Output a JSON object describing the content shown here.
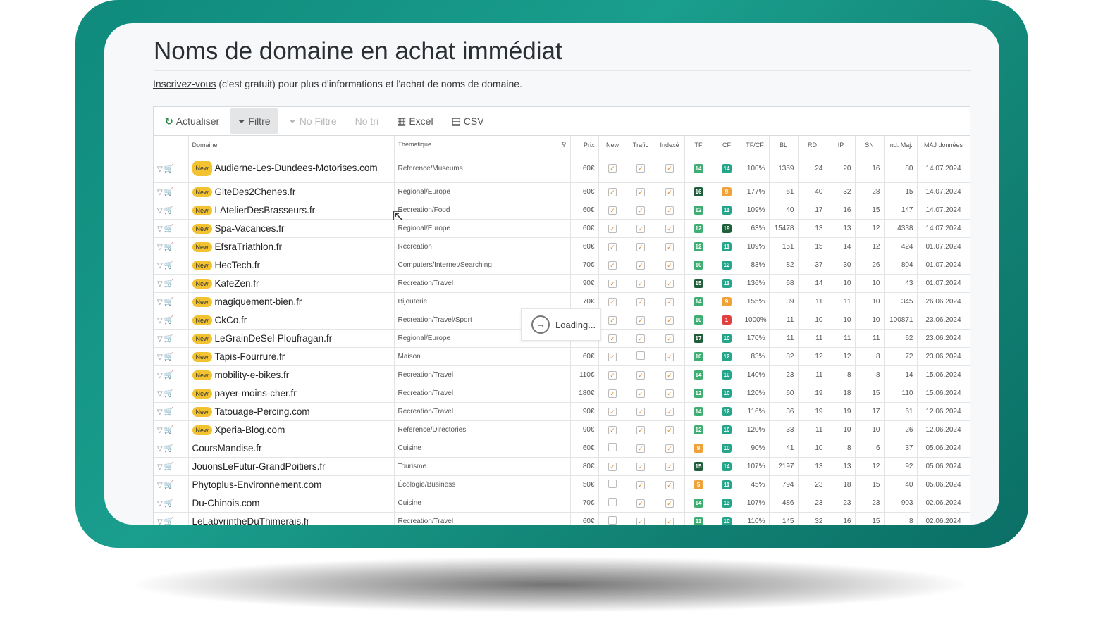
{
  "page": {
    "title": "Noms de domaine en achat immédiat",
    "intro_link": "Inscrivez-vous",
    "intro_text": " (c'est gratuit) pour plus d'informations et l'achat de noms de domaine."
  },
  "toolbar": {
    "refresh": "Actualiser",
    "filter": "Filtre",
    "no_filter": "No Filtre",
    "no_sort": "No tri",
    "excel": "Excel",
    "csv": "CSV"
  },
  "columns": {
    "domain": "Domaine",
    "theme": "Thématique",
    "price": "Prix",
    "new": "New",
    "traffic": "Trafic",
    "indexed": "Indexé",
    "tf": "TF",
    "cf": "CF",
    "tfcf": "TF/CF",
    "bl": "BL",
    "rd": "RD",
    "ip": "IP",
    "sn": "SN",
    "ind": "Ind. Maj.",
    "maj": "MAJ données"
  },
  "badge_new": "New",
  "loading": "Loading...",
  "colors": {
    "tf_green": "#3fae73",
    "tf_dark": "#1f5e3b",
    "cf_orange": "#f0a23a",
    "cf_red": "#e04040",
    "cf_teal": "#27a58a"
  },
  "rows": [
    {
      "domain": "Audierne-Les-Dundees-Motorises.com",
      "new": true,
      "theme": "Reference/Museums",
      "price": "60€",
      "n": true,
      "t": true,
      "i": true,
      "tf": "14",
      "tfc": "tf_green",
      "cf": "14",
      "cfc": "cf_teal",
      "tfcf": "100%",
      "bl": "1359",
      "rd": "24",
      "ip": "20",
      "sn": "16",
      "ind": "80",
      "maj": "14.07.2024"
    },
    {
      "domain": "GiteDes2Chenes.fr",
      "new": true,
      "theme": "Regional/Europe",
      "price": "60€",
      "n": true,
      "t": true,
      "i": true,
      "tf": "16",
      "tfc": "tf_dark",
      "cf": "9",
      "cfc": "cf_orange",
      "tfcf": "177%",
      "bl": "61",
      "rd": "40",
      "ip": "32",
      "sn": "28",
      "ind": "15",
      "maj": "14.07.2024"
    },
    {
      "domain": "LAtelierDesBrasseurs.fr",
      "new": true,
      "theme": "Recreation/Food",
      "price": "60€",
      "n": true,
      "t": true,
      "i": true,
      "tf": "12",
      "tfc": "tf_green",
      "cf": "11",
      "cfc": "cf_teal",
      "tfcf": "109%",
      "bl": "40",
      "rd": "17",
      "ip": "16",
      "sn": "15",
      "ind": "147",
      "maj": "14.07.2024"
    },
    {
      "domain": "Spa-Vacances.fr",
      "new": true,
      "theme": "Regional/Europe",
      "price": "60€",
      "n": true,
      "t": true,
      "i": true,
      "tf": "12",
      "tfc": "tf_green",
      "cf": "19",
      "cfc": "tf_dark",
      "tfcf": "63%",
      "bl": "15478",
      "rd": "13",
      "ip": "13",
      "sn": "12",
      "ind": "4338",
      "maj": "14.07.2024"
    },
    {
      "domain": "EfsraTriathlon.fr",
      "new": true,
      "theme": "Recreation",
      "price": "60€",
      "n": true,
      "t": true,
      "i": true,
      "tf": "12",
      "tfc": "tf_green",
      "cf": "11",
      "cfc": "cf_teal",
      "tfcf": "109%",
      "bl": "151",
      "rd": "15",
      "ip": "14",
      "sn": "12",
      "ind": "424",
      "maj": "01.07.2024"
    },
    {
      "domain": "HecTech.fr",
      "new": true,
      "theme": "Computers/Internet/Searching",
      "price": "70€",
      "n": true,
      "t": true,
      "i": true,
      "tf": "10",
      "tfc": "tf_green",
      "cf": "12",
      "cfc": "cf_teal",
      "tfcf": "83%",
      "bl": "82",
      "rd": "37",
      "ip": "30",
      "sn": "26",
      "ind": "804",
      "maj": "01.07.2024"
    },
    {
      "domain": "KafeZen.fr",
      "new": true,
      "theme": "Recreation/Travel",
      "price": "90€",
      "n": true,
      "t": true,
      "i": true,
      "tf": "15",
      "tfc": "tf_dark",
      "cf": "11",
      "cfc": "cf_teal",
      "tfcf": "136%",
      "bl": "68",
      "rd": "14",
      "ip": "10",
      "sn": "10",
      "ind": "43",
      "maj": "01.07.2024"
    },
    {
      "domain": "magiquement-bien.fr",
      "new": true,
      "theme": "Bijouterie",
      "price": "70€",
      "n": true,
      "t": true,
      "i": true,
      "tf": "14",
      "tfc": "tf_green",
      "cf": "9",
      "cfc": "cf_orange",
      "tfcf": "155%",
      "bl": "39",
      "rd": "11",
      "ip": "11",
      "sn": "10",
      "ind": "345",
      "maj": "26.06.2024"
    },
    {
      "domain": "CkCo.fr",
      "new": true,
      "theme": "Recreation/Travel/Sport",
      "price": "",
      "n": true,
      "t": true,
      "i": true,
      "tf": "10",
      "tfc": "tf_green",
      "cf": "1",
      "cfc": "cf_red",
      "tfcf": "1000%",
      "bl": "11",
      "rd": "10",
      "ip": "10",
      "sn": "10",
      "ind": "100871",
      "maj": "23.06.2024"
    },
    {
      "domain": "LeGrainDeSel-Ploufragan.fr",
      "new": true,
      "theme": "Regional/Europe",
      "price": "",
      "n": true,
      "t": true,
      "i": true,
      "tf": "17",
      "tfc": "tf_dark",
      "cf": "10",
      "cfc": "cf_teal",
      "tfcf": "170%",
      "bl": "11",
      "rd": "11",
      "ip": "11",
      "sn": "11",
      "ind": "62",
      "maj": "23.06.2024"
    },
    {
      "domain": "Tapis-Fourrure.fr",
      "new": true,
      "theme": "Maison",
      "price": "60€",
      "n": true,
      "t": false,
      "i": true,
      "tf": "10",
      "tfc": "tf_green",
      "cf": "12",
      "cfc": "cf_teal",
      "tfcf": "83%",
      "bl": "82",
      "rd": "12",
      "ip": "12",
      "sn": "8",
      "ind": "72",
      "maj": "23.06.2024"
    },
    {
      "domain": "mobility-e-bikes.fr",
      "new": true,
      "theme": "Recreation/Travel",
      "price": "110€",
      "n": true,
      "t": true,
      "i": true,
      "tf": "14",
      "tfc": "tf_green",
      "cf": "10",
      "cfc": "cf_teal",
      "tfcf": "140%",
      "bl": "23",
      "rd": "11",
      "ip": "8",
      "sn": "8",
      "ind": "14",
      "maj": "15.06.2024"
    },
    {
      "domain": "payer-moins-cher.fr",
      "new": true,
      "theme": "Recreation/Travel",
      "price": "180€",
      "n": true,
      "t": true,
      "i": true,
      "tf": "12",
      "tfc": "tf_green",
      "cf": "10",
      "cfc": "cf_teal",
      "tfcf": "120%",
      "bl": "60",
      "rd": "19",
      "ip": "18",
      "sn": "15",
      "ind": "110",
      "maj": "15.06.2024"
    },
    {
      "domain": "Tatouage-Percing.com",
      "new": true,
      "theme": "Recreation/Travel",
      "price": "90€",
      "n": true,
      "t": true,
      "i": true,
      "tf": "14",
      "tfc": "tf_green",
      "cf": "12",
      "cfc": "cf_teal",
      "tfcf": "116%",
      "bl": "36",
      "rd": "19",
      "ip": "19",
      "sn": "17",
      "ind": "61",
      "maj": "12.06.2024"
    },
    {
      "domain": "Xperia-Blog.com",
      "new": true,
      "theme": "Reference/Directories",
      "price": "90€",
      "n": true,
      "t": true,
      "i": true,
      "tf": "12",
      "tfc": "tf_green",
      "cf": "10",
      "cfc": "cf_teal",
      "tfcf": "120%",
      "bl": "33",
      "rd": "11",
      "ip": "10",
      "sn": "10",
      "ind": "26",
      "maj": "12.06.2024"
    },
    {
      "domain": "CoursMandise.fr",
      "new": false,
      "theme": "Cuisine",
      "price": "60€",
      "n": false,
      "t": true,
      "i": true,
      "tf": "9",
      "tfc": "cf_orange",
      "cf": "10",
      "cfc": "cf_teal",
      "tfcf": "90%",
      "bl": "41",
      "rd": "10",
      "ip": "8",
      "sn": "6",
      "ind": "37",
      "maj": "05.06.2024"
    },
    {
      "domain": "JouonsLeFutur-GrandPoitiers.fr",
      "new": false,
      "theme": "Tourisme",
      "price": "80€",
      "n": true,
      "t": true,
      "i": true,
      "tf": "15",
      "tfc": "tf_dark",
      "cf": "14",
      "cfc": "cf_teal",
      "tfcf": "107%",
      "bl": "2197",
      "rd": "13",
      "ip": "13",
      "sn": "12",
      "ind": "92",
      "maj": "05.06.2024"
    },
    {
      "domain": "Phytoplus-Environnement.com",
      "new": false,
      "theme": "Écologie/Business",
      "price": "50€",
      "n": false,
      "t": true,
      "i": true,
      "tf": "5",
      "tfc": "cf_orange",
      "cf": "11",
      "cfc": "cf_teal",
      "tfcf": "45%",
      "bl": "794",
      "rd": "23",
      "ip": "18",
      "sn": "15",
      "ind": "40",
      "maj": "05.06.2024"
    },
    {
      "domain": "Du-Chinois.com",
      "new": false,
      "theme": "Cuisine",
      "price": "70€",
      "n": false,
      "t": true,
      "i": true,
      "tf": "14",
      "tfc": "tf_green",
      "cf": "13",
      "cfc": "cf_teal",
      "tfcf": "107%",
      "bl": "486",
      "rd": "23",
      "ip": "23",
      "sn": "23",
      "ind": "903",
      "maj": "02.06.2024"
    },
    {
      "domain": "LeLabyrintheDuThimerais.fr",
      "new": false,
      "theme": "Recreation/Travel",
      "price": "60€",
      "n": false,
      "t": true,
      "i": true,
      "tf": "11",
      "tfc": "tf_green",
      "cf": "10",
      "cfc": "cf_teal",
      "tfcf": "110%",
      "bl": "145",
      "rd": "32",
      "ip": "16",
      "sn": "15",
      "ind": "8",
      "maj": "02.06.2024"
    }
  ]
}
